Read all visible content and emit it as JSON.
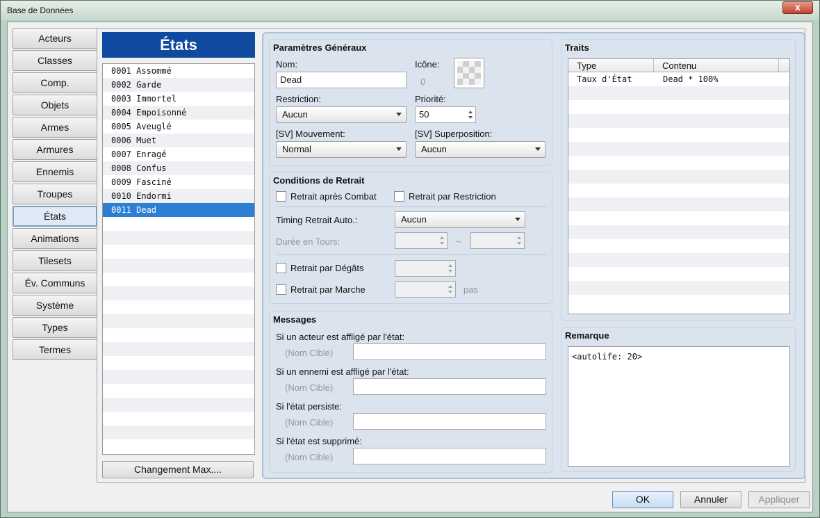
{
  "window": {
    "title": "Base de Données",
    "close_glyph": "x"
  },
  "nav": [
    "Acteurs",
    "Classes",
    "Comp.",
    "Objets",
    "Armes",
    "Armures",
    "Ennemis",
    "Troupes",
    "États",
    "Animations",
    "Tilesets",
    "Év. Communs",
    "Système",
    "Types",
    "Termes"
  ],
  "nav_active": "États",
  "list": {
    "header": "États",
    "items": [
      "0001 Assommé",
      "0002 Garde",
      "0003 Immortel",
      "0004 Empoisonné",
      "0005 Aveuglé",
      "0006 Muet",
      "0007 Enragé",
      "0008 Confus",
      "0009 Fasciné",
      "0010 Endormi",
      "0011 Dead"
    ],
    "selected": "0011 Dead",
    "max_button": "Changement Max...."
  },
  "general": {
    "title": "Paramètres Généraux",
    "name_label": "Nom:",
    "name_value": "Dead",
    "icon_label": "Icône:",
    "icon_index": "0",
    "restriction_label": "Restriction:",
    "restriction_value": "Aucun",
    "priority_label": "Priorité:",
    "priority_value": "50",
    "motion_label": "[SV] Mouvement:",
    "motion_value": "Normal",
    "overlay_label": "[SV] Superposition:",
    "overlay_value": "Aucun"
  },
  "removal": {
    "title": "Conditions de Retrait",
    "after_battle": "Retrait après Combat",
    "by_restriction": "Retrait par Restriction",
    "auto_timing_label": "Timing Retrait Auto.:",
    "auto_timing_value": "Aucun",
    "duration_label": "Durée en Tours:",
    "tilde": "~",
    "by_damage": "Retrait par Dégâts",
    "by_walking": "Retrait par Marche",
    "steps_unit": "pas"
  },
  "messages": {
    "title": "Messages",
    "placeholder": "(Nom Cible)",
    "items": [
      "Si un acteur est affligé par l'état:",
      "Si un ennemi est affligé par l'état:",
      "Si l'état persiste:",
      "Si l'état est supprimé:"
    ]
  },
  "traits": {
    "title": "Traits",
    "columns": [
      "Type",
      "Contenu"
    ],
    "rows": [
      [
        "Taux d'État",
        "Dead * 100%"
      ]
    ]
  },
  "remark": {
    "title": "Remarque",
    "text": "<autolife: 20>"
  },
  "buttons": {
    "ok": "OK",
    "cancel": "Annuler",
    "apply": "Appliquer"
  },
  "colors": {
    "list_header": "#0f4aa0",
    "selection": "#2d7fd3",
    "panel": "#dbe4ee"
  }
}
